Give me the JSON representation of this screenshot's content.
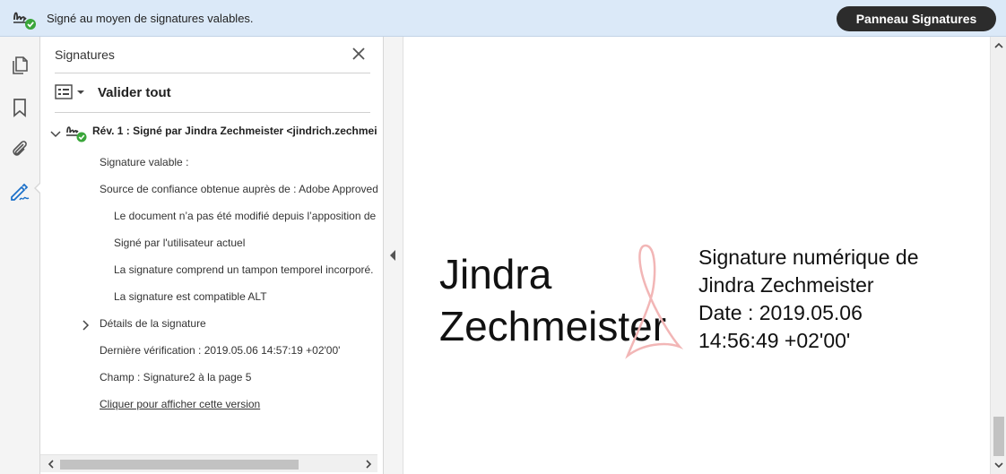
{
  "topbar": {
    "message": "Signé au moyen de signatures valables.",
    "button_label": "Panneau Signatures"
  },
  "rail": {
    "icons": [
      "pages-icon",
      "bookmark-icon",
      "attachment-icon",
      "signature-pen-icon"
    ]
  },
  "panel": {
    "title": "Signatures",
    "validate_all": "Valider tout",
    "revision": "Rév. 1 : Signé par Jindra Zechmeister <jindrich.zechmeister",
    "lines": {
      "valid": "Signature valable :",
      "trust": "Source de confiance obtenue auprès de : Adobe Approved",
      "unmodified": "Le document n’a pas été modifié depuis l’apposition de",
      "current_user": "Signé par l'utilisateur actuel",
      "timestamp": "La signature comprend un tampon temporel incorporé.",
      "alt": "La signature est compatible ALT",
      "details": "Détails de la signature",
      "last_check": "Dernière vérification : 2019.05.06 14:57:19 +02'00'",
      "field": "Champ : Signature2 à la page 5",
      "view_link": "Cliquer pour afficher cette version"
    }
  },
  "document": {
    "signer_line1": "Jindra",
    "signer_line2": "Zechmeister",
    "details_line1": "Signature numérique de",
    "details_line2": "Jindra Zechmeister",
    "details_line3": "Date : 2019.05.06",
    "details_line4": "14:56:49 +02'00'"
  },
  "colors": {
    "topbar_bg": "#dbe9f8",
    "button_bg": "#2c2c2c",
    "valid_green": "#3aa63a",
    "accent_blue": "#1a6fc8",
    "acrobat_pink": "#f2b6b6"
  }
}
